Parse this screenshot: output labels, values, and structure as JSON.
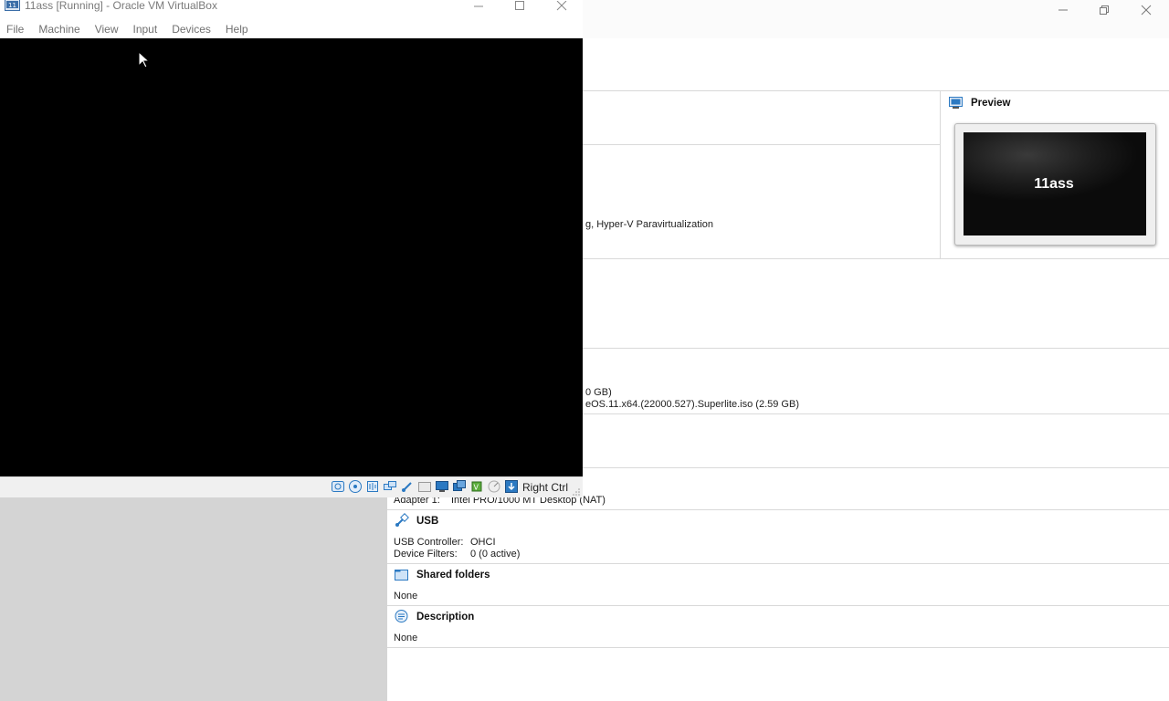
{
  "vm_window": {
    "title": "11ass [Running] - Oracle VM VirtualBox",
    "menus": [
      "File",
      "Machine",
      "View",
      "Input",
      "Devices",
      "Help"
    ],
    "host_key": "Right Ctrl",
    "status_icons": [
      "hard-disk-icon",
      "optical-drive-icon",
      "audio-icon",
      "network-icon",
      "usb-icon",
      "shared-folders-icon",
      "display-icon",
      "video-capture-icon",
      "cpu-icon",
      "mouse-integration-icon",
      "host-key-icon"
    ]
  },
  "manager": {
    "system_acceleration_partial": "g, Hyper-V Paravirtualization",
    "storage_disk_partial": "0 GB)",
    "storage_optical_partial": "eOS.11.x64.(22000.527).Superlite.iso (2.59 GB)",
    "network": {
      "adapter_label": "Adapter 1:",
      "adapter_value": "Intel PRO/1000 MT Desktop (NAT)"
    },
    "usb": {
      "title": "USB",
      "controller_label": "USB Controller:",
      "controller_value": "OHCI",
      "filters_label": "Device Filters:",
      "filters_value": "0 (0 active)"
    },
    "shared_folders": {
      "title": "Shared folders",
      "value": "None"
    },
    "description": {
      "title": "Description",
      "value": "None"
    },
    "preview": {
      "title": "Preview",
      "vm_name": "11ass"
    }
  },
  "colors": {
    "vm_screen": "#000000",
    "sidebar": "#d4d4d4",
    "accent_blue": "#2b79c2"
  }
}
